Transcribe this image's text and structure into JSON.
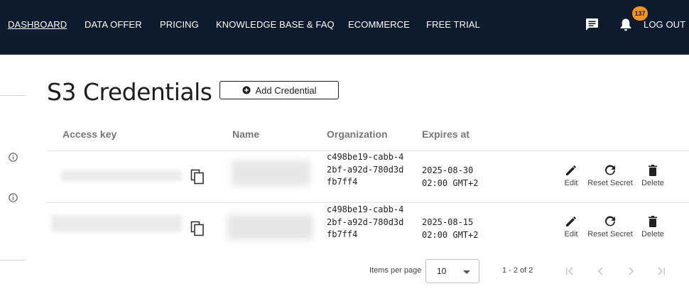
{
  "nav": {
    "items": [
      {
        "label": "DASHBOARD",
        "active": true
      },
      {
        "label": "DATA OFFER"
      },
      {
        "label": "PRICING"
      },
      {
        "label": "KNOWLEDGE BASE & FAQ"
      },
      {
        "label": "ECOMMERCE"
      },
      {
        "label": "FREE TRIAL"
      }
    ],
    "notification_count": "137",
    "logout_label": "LOG OUT",
    "chat_icon": "chat-icon",
    "bell_icon": "bell-icon"
  },
  "page": {
    "title": "S3 Credentials",
    "add_button_label": "Add Credential"
  },
  "table": {
    "headers": [
      "Access key",
      "Name",
      "Organization",
      "Expires at"
    ],
    "rows": [
      {
        "access_key": "",
        "name": "",
        "organization": "c498be19-cabb-42bf-a92d-780d3dfb7ff4",
        "expires_date": "2025-08-30",
        "expires_time": "02:00 GMT+2"
      },
      {
        "access_key": "",
        "name": "",
        "organization": "c498be19-cabb-42bf-a92d-780d3dfb7ff4",
        "expires_date": "2025-08-15",
        "expires_time": "02:00 GMT+2"
      }
    ],
    "actions": {
      "edit": "Edit",
      "reset": "Reset Secret",
      "delete": "Delete"
    }
  },
  "pagination": {
    "items_per_page_label": "Items per page",
    "items_per_page_value": "10",
    "range_label": "1 - 2 of 2"
  },
  "colors": {
    "nav_bg": "#0e1b2f",
    "badge": "#f7941d"
  }
}
